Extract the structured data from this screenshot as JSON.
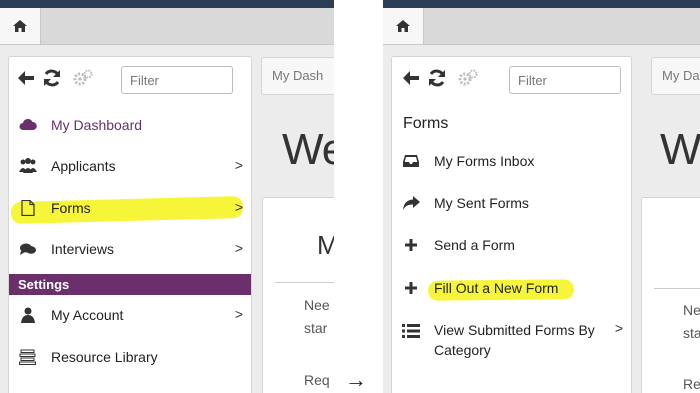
{
  "left": {
    "filter_placeholder": "Filter",
    "nav": [
      {
        "label": "My Dashboard",
        "icon": "cloud-icon",
        "color": "#6b2f6b"
      },
      {
        "label": "Applicants",
        "icon": "users-icon",
        "chevron": ">"
      },
      {
        "label": "Forms",
        "icon": "document-icon",
        "chevron": ">",
        "highlighted": true
      },
      {
        "label": "Interviews",
        "icon": "comments-icon",
        "chevron": ">"
      }
    ],
    "settings_header": "Settings",
    "settings": [
      {
        "label": "My Account",
        "icon": "user-icon",
        "chevron": ">"
      },
      {
        "label": "Resource Library",
        "icon": "library-icon"
      }
    ],
    "breadcrumb": "My Dash",
    "title": "We",
    "card": {
      "heading": "M",
      "line1": "Nee",
      "line2": "star",
      "line3": "Req"
    }
  },
  "arrow": "→",
  "right": {
    "filter_placeholder": "Filter",
    "heading": "Forms",
    "items": [
      {
        "label": "My Forms Inbox",
        "icon": "inbox-icon"
      },
      {
        "label": "My Sent Forms",
        "icon": "share-icon"
      },
      {
        "label": "Send a Form",
        "icon": "plus-icon"
      },
      {
        "label": "Fill Out a New Form",
        "icon": "plus-icon",
        "highlighted": true
      },
      {
        "label": "View Submitted Forms By Category",
        "icon": "list-icon",
        "chevron": ">"
      }
    ],
    "breadcrumb": "My Da",
    "title": "We",
    "card": {
      "line1": "Ne",
      "line2": "sta",
      "line3": "Re"
    }
  },
  "colors": {
    "accent": "#6b2f6b",
    "highlight": "#f7f53a",
    "topbar": "#2c3e55"
  }
}
